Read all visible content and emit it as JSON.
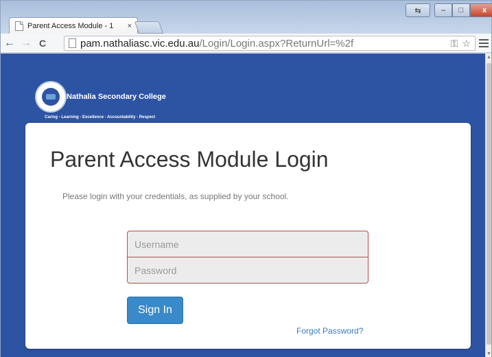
{
  "browser": {
    "tab_title": "Parent Access Module - 1",
    "tab_close": "×",
    "url_host": "pam.nathaliasc.vic.edu.au",
    "url_path": "/Login/Login.aspx?ReturnUrl=%2f",
    "back_glyph": "←",
    "forward_glyph": "→",
    "reload_glyph": "C",
    "key_glyph": "⚿",
    "star_glyph": "☆",
    "minimize_glyph": "–",
    "maximize_glyph": "□",
    "close_glyph": "x"
  },
  "header": {
    "school_name": "Nathalia Secondary College",
    "motto": "Caring - Learning - Excellence - Accountability - Respect"
  },
  "login": {
    "title": "Parent Access Module Login",
    "subtitle": "Please login with your credentials, as supplied by your school.",
    "username_placeholder": "Username",
    "password_placeholder": "Password",
    "sign_in_label": "Sign In",
    "forgot_label": "Forgot Password?"
  },
  "colors": {
    "page_background": "#2d53a3",
    "button": "#3a89c9",
    "field_border": "#c0474a",
    "link": "#3a7bbf"
  }
}
